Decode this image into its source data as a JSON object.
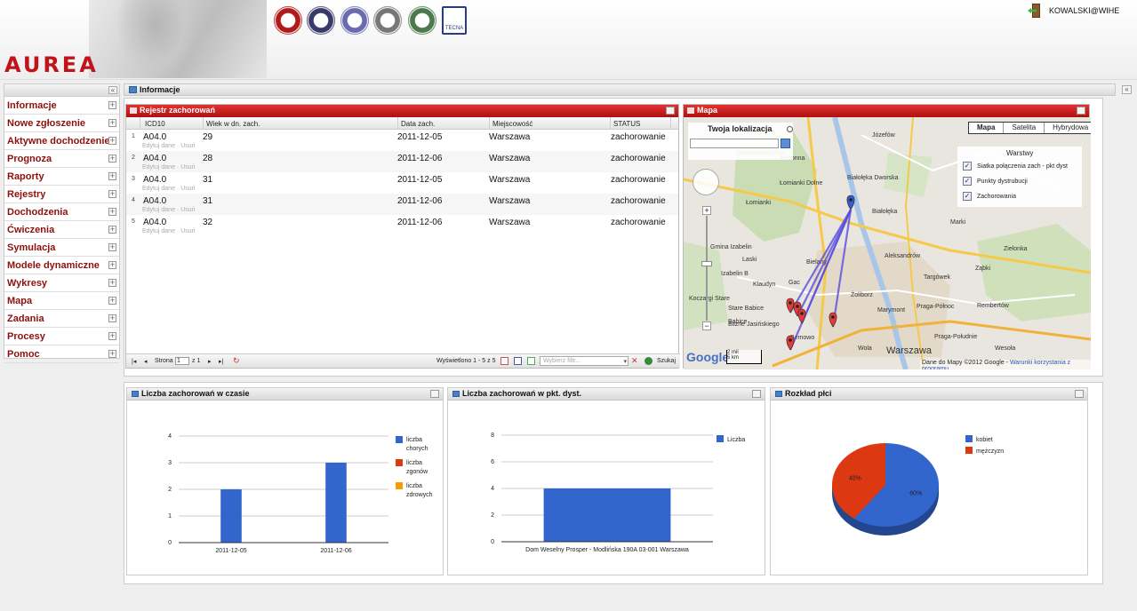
{
  "header": {
    "brand": "AUREA",
    "user": "KOWALSKI@WIHE",
    "partners": [
      {
        "name": "wihe-logo",
        "label": "WIHE",
        "color": "#b11a1a"
      },
      {
        "name": "crest-logo",
        "label": "",
        "color": "#3a3a6a"
      },
      {
        "name": "ichf-logo",
        "label": "ichf",
        "color": "#6a6ab0"
      },
      {
        "name": "seal-logo",
        "label": "",
        "color": "#777777"
      },
      {
        "name": "green-seal-logo",
        "label": "",
        "color": "#4c7a4c"
      },
      {
        "name": "tecna-logo",
        "label": "TECNA",
        "color": "#2a3a8a"
      }
    ]
  },
  "nav": {
    "items": [
      {
        "label": "Informacje"
      },
      {
        "label": "Nowe zgłoszenie"
      },
      {
        "label": "Aktywne dochodzenie"
      },
      {
        "label": "Prognoza"
      },
      {
        "label": "Raporty"
      },
      {
        "label": "Rejestry"
      },
      {
        "label": "Dochodzenia"
      },
      {
        "label": "Ćwiczenia"
      },
      {
        "label": "Symulacja"
      },
      {
        "label": "Modele dynamiczne"
      },
      {
        "label": "Wykresy"
      },
      {
        "label": "Mapa"
      },
      {
        "label": "Zadania"
      },
      {
        "label": "Procesy"
      },
      {
        "label": "Pomoc"
      }
    ]
  },
  "main": {
    "title": "Informacje"
  },
  "registry": {
    "title": "Rejestr zachorowań",
    "columns": [
      "ICD10",
      "Wiek w dn. zach.",
      "Data zach.",
      "Miejscowość",
      "STATUS"
    ],
    "rows": [
      {
        "n": "1",
        "icd": "A04.0",
        "age": "29",
        "date": "2011-12-05",
        "city": "Warszawa",
        "status": "zachorowanie"
      },
      {
        "n": "2",
        "icd": "A04.0",
        "age": "28",
        "date": "2011-12-06",
        "city": "Warszawa",
        "status": "zachorowanie"
      },
      {
        "n": "3",
        "icd": "A04.0",
        "age": "31",
        "date": "2011-12-05",
        "city": "Warszawa",
        "status": "zachorowanie"
      },
      {
        "n": "4",
        "icd": "A04.0",
        "age": "31",
        "date": "2011-12-06",
        "city": "Warszawa",
        "status": "zachorowanie"
      },
      {
        "n": "5",
        "icd": "A04.0",
        "age": "32",
        "date": "2011-12-06",
        "city": "Warszawa",
        "status": "zachorowanie"
      }
    ],
    "row_actions": "Edytuj dane · Usuń",
    "pager": {
      "page_label": "Strona",
      "page_value": "1",
      "page_of": "z 1",
      "displayed": "Wyświetlono 1 - 5 z 5",
      "filter_placeholder": "Wybierz filtr...",
      "search": "Szukaj"
    }
  },
  "map": {
    "title": "Mapa",
    "geo_title": "Twoja lokalizacja",
    "types": [
      "Mapa",
      "Satelita",
      "Hybrydowa"
    ],
    "selected_type": "Mapa",
    "layers_title": "Warstwy",
    "layers": [
      {
        "label": "Siatka połączenia zach - pkt dyst",
        "checked": true
      },
      {
        "label": "Punkty dystrubucji",
        "checked": true
      },
      {
        "label": "Zachorowania",
        "checked": true
      }
    ],
    "google": "Google",
    "scale_mi": "2 mil",
    "scale_km": "5 km",
    "attribution": "Dane do Mapy ©2012 Google -",
    "terms": "Warunki korzystania z programu",
    "places": [
      {
        "name": "Józefów"
      },
      {
        "name": "Jabłonna"
      },
      {
        "name": "Białołęka Dworska"
      },
      {
        "name": "Łomianki Dolne"
      },
      {
        "name": "Dziekanów Leśny"
      },
      {
        "name": "Łomianki"
      },
      {
        "name": "Białołęka"
      },
      {
        "name": "Marki"
      },
      {
        "name": "Zielonka"
      },
      {
        "name": "Gmina Izabelin"
      },
      {
        "name": "Aleksandrów"
      },
      {
        "name": "Ząbki"
      },
      {
        "name": "Bielany"
      },
      {
        "name": "Laski"
      },
      {
        "name": "Izabelin B"
      },
      {
        "name": "Klaudyn"
      },
      {
        "name": "Gac"
      },
      {
        "name": "Targówek"
      },
      {
        "name": "Żoliborz"
      },
      {
        "name": "Stare Babice"
      },
      {
        "name": "Babice"
      },
      {
        "name": "Marymont"
      },
      {
        "name": "Praga-Północ"
      },
      {
        "name": "Rembertów"
      },
      {
        "name": "Blizne Jasińskiego"
      },
      {
        "name": "Bemowo"
      },
      {
        "name": "Praga-Południe"
      },
      {
        "name": "Wola"
      },
      {
        "name": "Warszawa"
      },
      {
        "name": "Wesoła"
      },
      {
        "name": "Koczargi Stare"
      }
    ]
  },
  "charts": {
    "time_title": "Liczba zachorowań w czasie",
    "dist_title": "Liczba zachorowań w pkt. dyst.",
    "sex_title": "Rozkład płci"
  },
  "chart_data": [
    {
      "type": "bar",
      "title": "Liczba zachorowań w czasie",
      "categories": [
        "2011-12-05",
        "2011-12-06"
      ],
      "series": [
        {
          "name": "liczba chorych",
          "values": [
            2,
            3
          ],
          "color": "#3366cc"
        },
        {
          "name": "liczba zgonów",
          "values": [
            0,
            0
          ],
          "color": "#dc3912"
        },
        {
          "name": "liczba zdrowych",
          "values": [
            0,
            0
          ],
          "color": "#ff9900"
        }
      ],
      "ylim": [
        0,
        4
      ],
      "yticks": [
        0,
        1,
        2,
        3,
        4
      ],
      "legend": "right"
    },
    {
      "type": "bar",
      "title": "Liczba zachorowań w pkt. dyst.",
      "categories": [
        "Dom Weselny Prosper - Modlińska 190A 03-001 Warszawa"
      ],
      "series": [
        {
          "name": "Liczba",
          "values": [
            4
          ],
          "color": "#3366cc"
        }
      ],
      "ylim": [
        0,
        8
      ],
      "yticks": [
        0,
        2,
        4,
        6,
        8
      ],
      "legend": "right"
    },
    {
      "type": "pie",
      "title": "Rozkład płci",
      "labels": [
        "kobiet",
        "mężczyzn"
      ],
      "values": [
        60,
        40
      ],
      "display": [
        "60%",
        "40%"
      ],
      "colors": [
        "#3366cc",
        "#dc3912"
      ],
      "legend": "right"
    }
  ]
}
